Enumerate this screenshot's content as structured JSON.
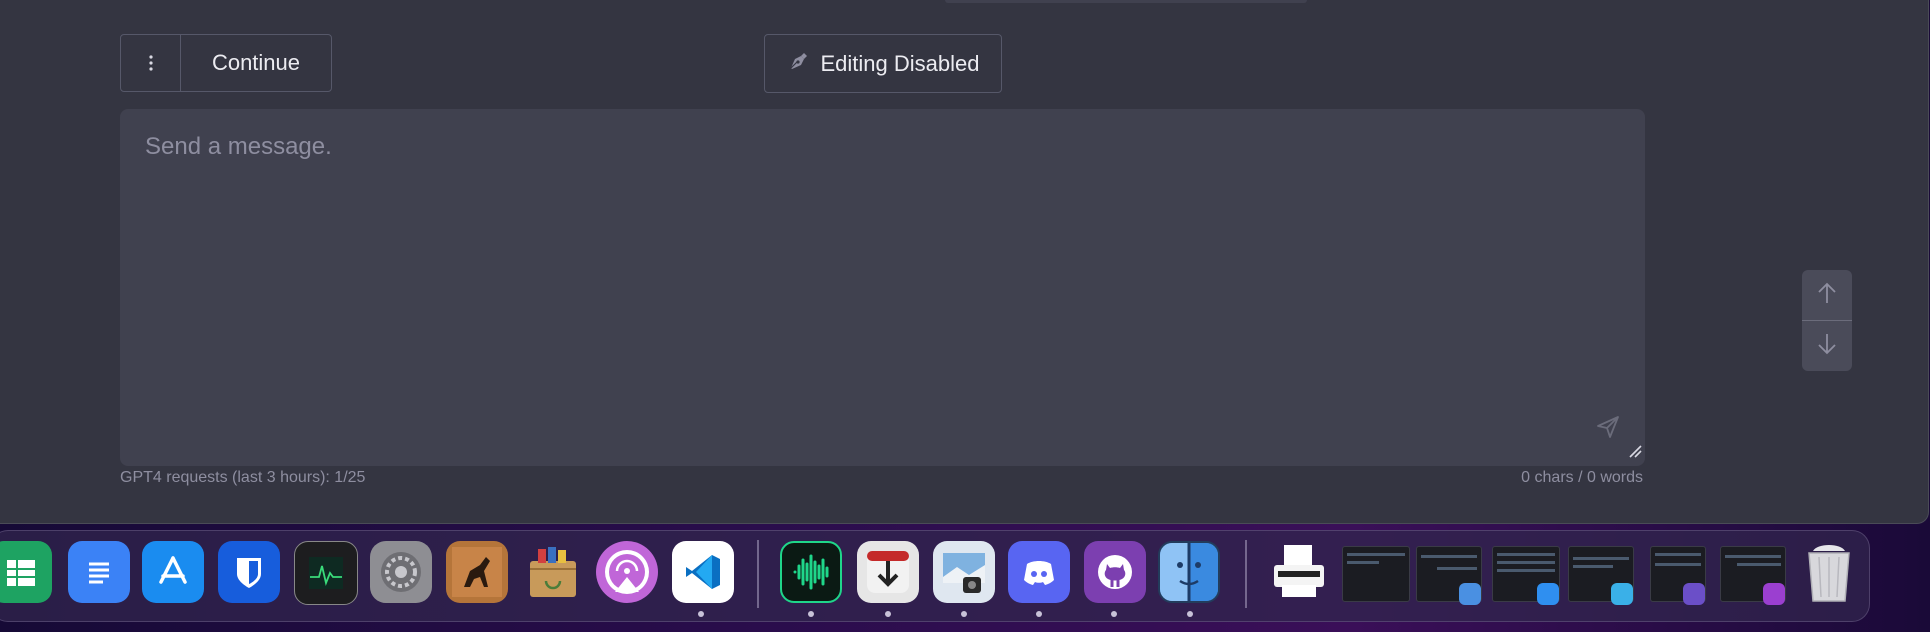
{
  "toolbar": {
    "menu_icon": "vertical-ellipsis-icon",
    "continue_label": "Continue",
    "editing_label": "Editing Disabled",
    "editing_icon": "pen-nib-icon"
  },
  "composer": {
    "placeholder": "Send a message.",
    "value": "",
    "send_icon": "paper-plane-icon"
  },
  "footer": {
    "requests_text": "GPT4 requests (last 3 hours): 1/25",
    "counter_text": "0 chars / 0 words"
  },
  "scroll_controls": {
    "up_icon": "arrow-up-icon",
    "down_icon": "arrow-down-icon"
  },
  "dock": {
    "apps": [
      {
        "name": "Google Sheets",
        "icon": "sheets-icon",
        "running": false
      },
      {
        "name": "Google Docs",
        "icon": "docs-icon",
        "running": false
      },
      {
        "name": "App Store",
        "icon": "app-store-icon",
        "running": false
      },
      {
        "name": "Bitwarden",
        "icon": "bitwarden-icon",
        "running": false
      },
      {
        "name": "Activity Monitor",
        "icon": "activity-monitor-icon",
        "running": false
      },
      {
        "name": "System Settings",
        "icon": "settings-icon",
        "running": false
      },
      {
        "name": "Horse game",
        "icon": "horse-icon",
        "running": false
      },
      {
        "name": "Archive Utility",
        "icon": "archive-icon",
        "running": false
      },
      {
        "name": "Podcast app",
        "icon": "podcast-icon",
        "running": false
      },
      {
        "name": "Visual Studio Code",
        "icon": "vscode-icon",
        "running": true
      },
      {
        "name": "Audio app",
        "icon": "waveform-icon",
        "running": true
      },
      {
        "name": "Downloader",
        "icon": "download-icon",
        "running": true
      },
      {
        "name": "Preview",
        "icon": "preview-icon",
        "running": true
      },
      {
        "name": "Discord",
        "icon": "discord-icon",
        "running": true
      },
      {
        "name": "GitHub Desktop",
        "icon": "github-icon",
        "running": true
      },
      {
        "name": "Finder",
        "icon": "finder-icon",
        "running": true
      }
    ],
    "minimized": [
      {
        "name": "Printer",
        "icon": "printer-icon"
      },
      {
        "name": "Window thumbnail 1",
        "icon": "window-thumbnail-icon"
      },
      {
        "name": "Window thumbnail 2",
        "icon": "window-thumbnail-icon"
      },
      {
        "name": "Window thumbnail 3",
        "icon": "window-thumbnail-icon"
      },
      {
        "name": "Window thumbnail 4",
        "icon": "window-thumbnail-icon"
      },
      {
        "name": "Window thumbnail 5",
        "icon": "window-thumbnail-icon"
      },
      {
        "name": "Window thumbnail 6",
        "icon": "window-thumbnail-icon"
      }
    ],
    "trash_icon": "trash-icon"
  },
  "colors": {
    "window_bg": "#343541",
    "input_bg": "#40414f",
    "border": "#565869",
    "muted_text": "#8e8ea0",
    "text": "#ececf1"
  }
}
